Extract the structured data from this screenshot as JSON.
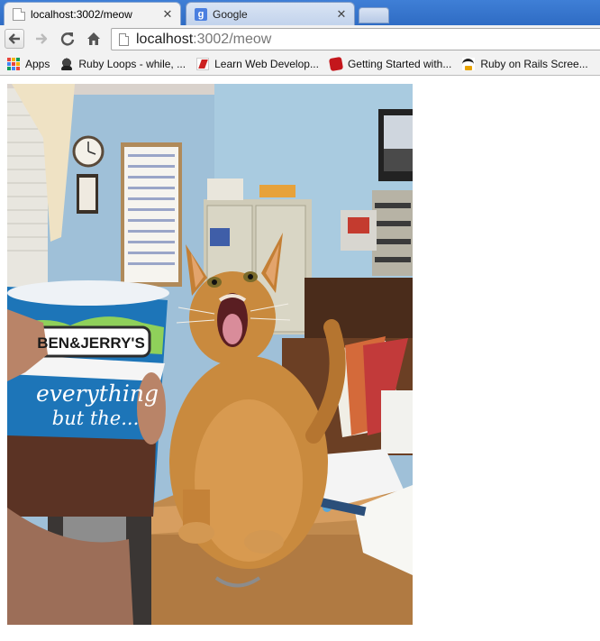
{
  "browser": {
    "tabs": [
      {
        "title": "localhost:3002/meow",
        "favicon": "page-icon",
        "active": true
      },
      {
        "title": "Google",
        "favicon": "google-icon",
        "active": false
      }
    ],
    "close_symbol": "✕",
    "address_bar": {
      "host": "localhost",
      "path": ":3002/meow"
    },
    "bookmarks": [
      {
        "label": "Apps",
        "icon": "apps-grid-icon"
      },
      {
        "label": "Ruby Loops - while, ...",
        "icon": "ruby-loops-icon"
      },
      {
        "label": "Learn Web Develop...",
        "icon": "learn-web-icon"
      },
      {
        "label": "Getting Started with...",
        "icon": "rails-icon"
      },
      {
        "label": "Ruby on Rails Scree...",
        "icon": "railscasts-icon"
      }
    ]
  },
  "page": {
    "image": {
      "subject": "cat-photo",
      "carton_text": [
        "BEN&JERRY'S",
        "everything",
        "but the..."
      ]
    }
  },
  "colors": {
    "tabstrip": "#3f7fd6",
    "toolbar": "#f2f2f2",
    "wall": "#9fc0d8",
    "cat": "#c98a3e",
    "desk": "#c08a4e",
    "carton": "#1d75b8"
  }
}
